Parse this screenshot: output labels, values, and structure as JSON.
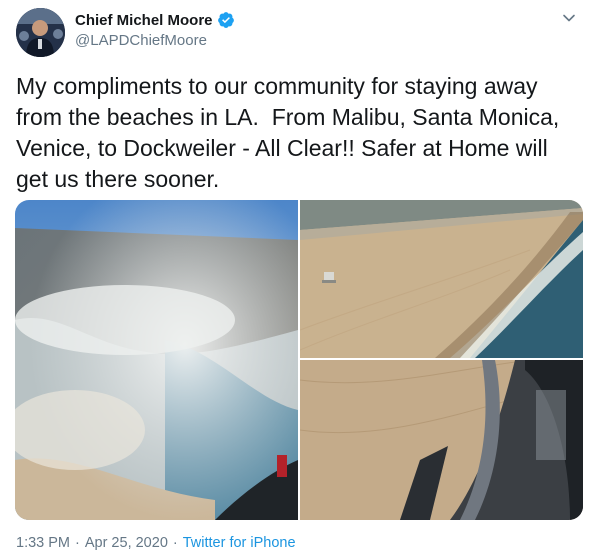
{
  "author": {
    "name": "Chief Michel Moore",
    "handle": "@LAPDChiefMoore",
    "verified_icon": "verified-badge-icon"
  },
  "tweet": {
    "text": "My compliments to our community for staying away from the beaches in LA.  From Malibu, Santa Monica, Venice, to Dockweiler - All Clear!! Safer at Home will get us there sooner."
  },
  "meta": {
    "time": "1:33 PM",
    "separator": "·",
    "date": "Apr 25, 2020",
    "source": "Twitter for iPhone"
  },
  "colors": {
    "text": "#14171a",
    "secondary": "#657786",
    "link": "#1b95e0",
    "verified": "#1da1f2"
  },
  "icons": {
    "menu": "chevron-down-icon"
  }
}
